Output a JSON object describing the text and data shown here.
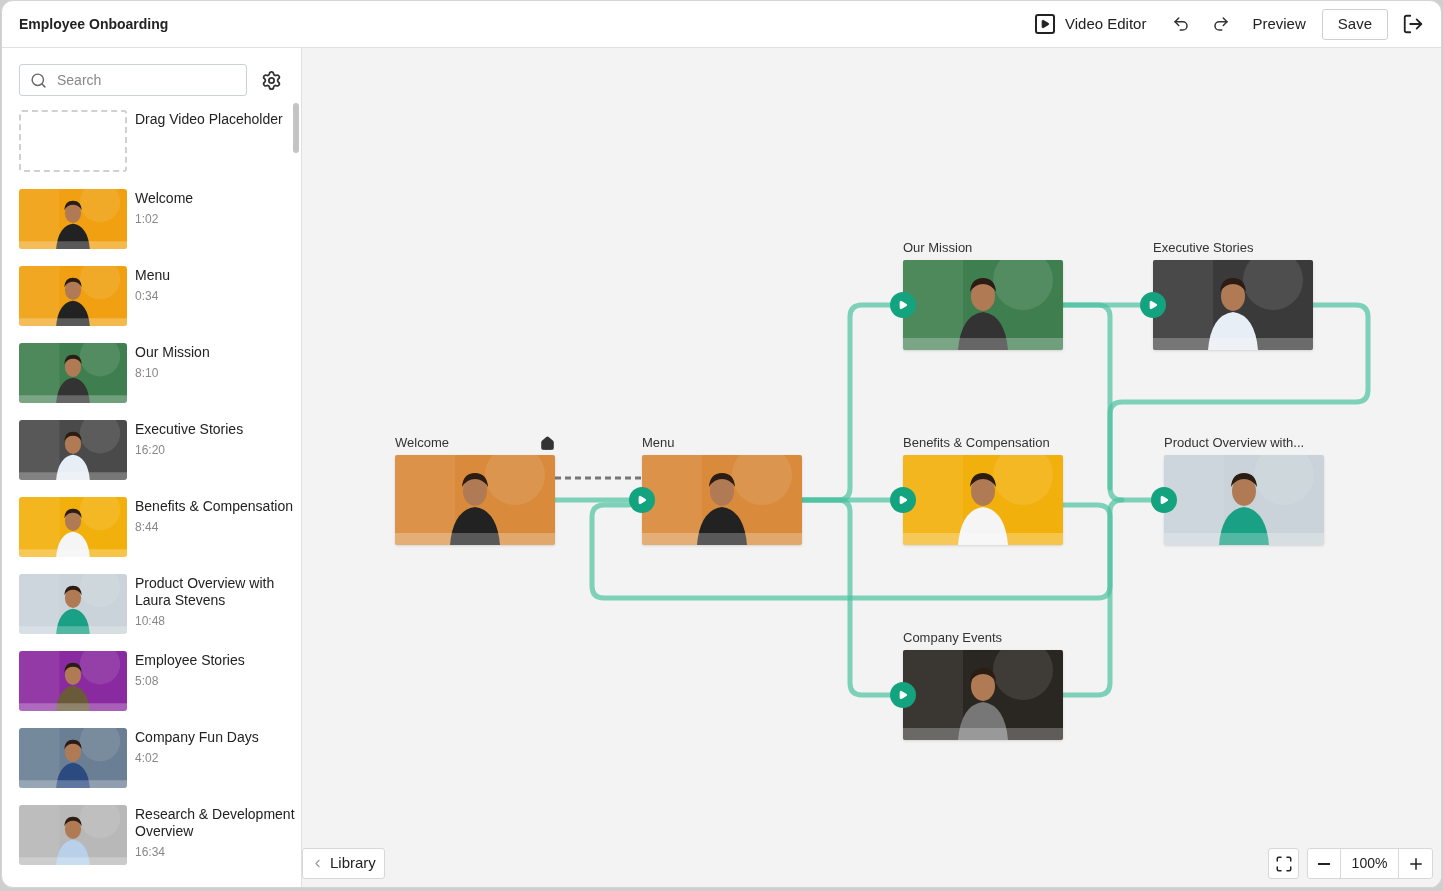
{
  "window": {
    "title": "Employee Onboarding"
  },
  "toolbar": {
    "video_editor": "Video Editor",
    "preview": "Preview",
    "save": "Save"
  },
  "sidebar": {
    "search": {
      "placeholder": "Search"
    },
    "items": [
      {
        "kind": "placeholder",
        "title": "Drag Video Placeholder"
      },
      {
        "kind": "video",
        "title": "Welcome",
        "duration": "1:02"
      },
      {
        "kind": "video",
        "title": "Menu",
        "duration": "0:34"
      },
      {
        "kind": "video",
        "title": "Our Mission",
        "duration": "8:10"
      },
      {
        "kind": "video",
        "title": "Executive Stories",
        "duration": "16:20"
      },
      {
        "kind": "video",
        "title": "Benefits & Compensation",
        "duration": "8:44"
      },
      {
        "kind": "video",
        "title": "Product Overview with Laura Stevens",
        "duration": "10:48"
      },
      {
        "kind": "video",
        "title": "Employee Stories",
        "duration": "5:08"
      },
      {
        "kind": "video",
        "title": "Company Fun Days",
        "duration": "4:02"
      },
      {
        "kind": "video",
        "title": "Research & Development Overview",
        "duration": "16:34"
      }
    ]
  },
  "canvas": {
    "nodes": [
      {
        "title": "Welcome",
        "start": true
      },
      {
        "title": "Menu",
        "start": false
      },
      {
        "title": "Our Mission",
        "start": false
      },
      {
        "title": "Executive Stories",
        "start": false
      },
      {
        "title": "Benefits & Compensation",
        "start": false
      },
      {
        "title": "Product Overview with...",
        "start": false
      },
      {
        "title": "Company Events",
        "start": false
      }
    ]
  },
  "footer": {
    "library": "Library",
    "zoom": "100%"
  }
}
